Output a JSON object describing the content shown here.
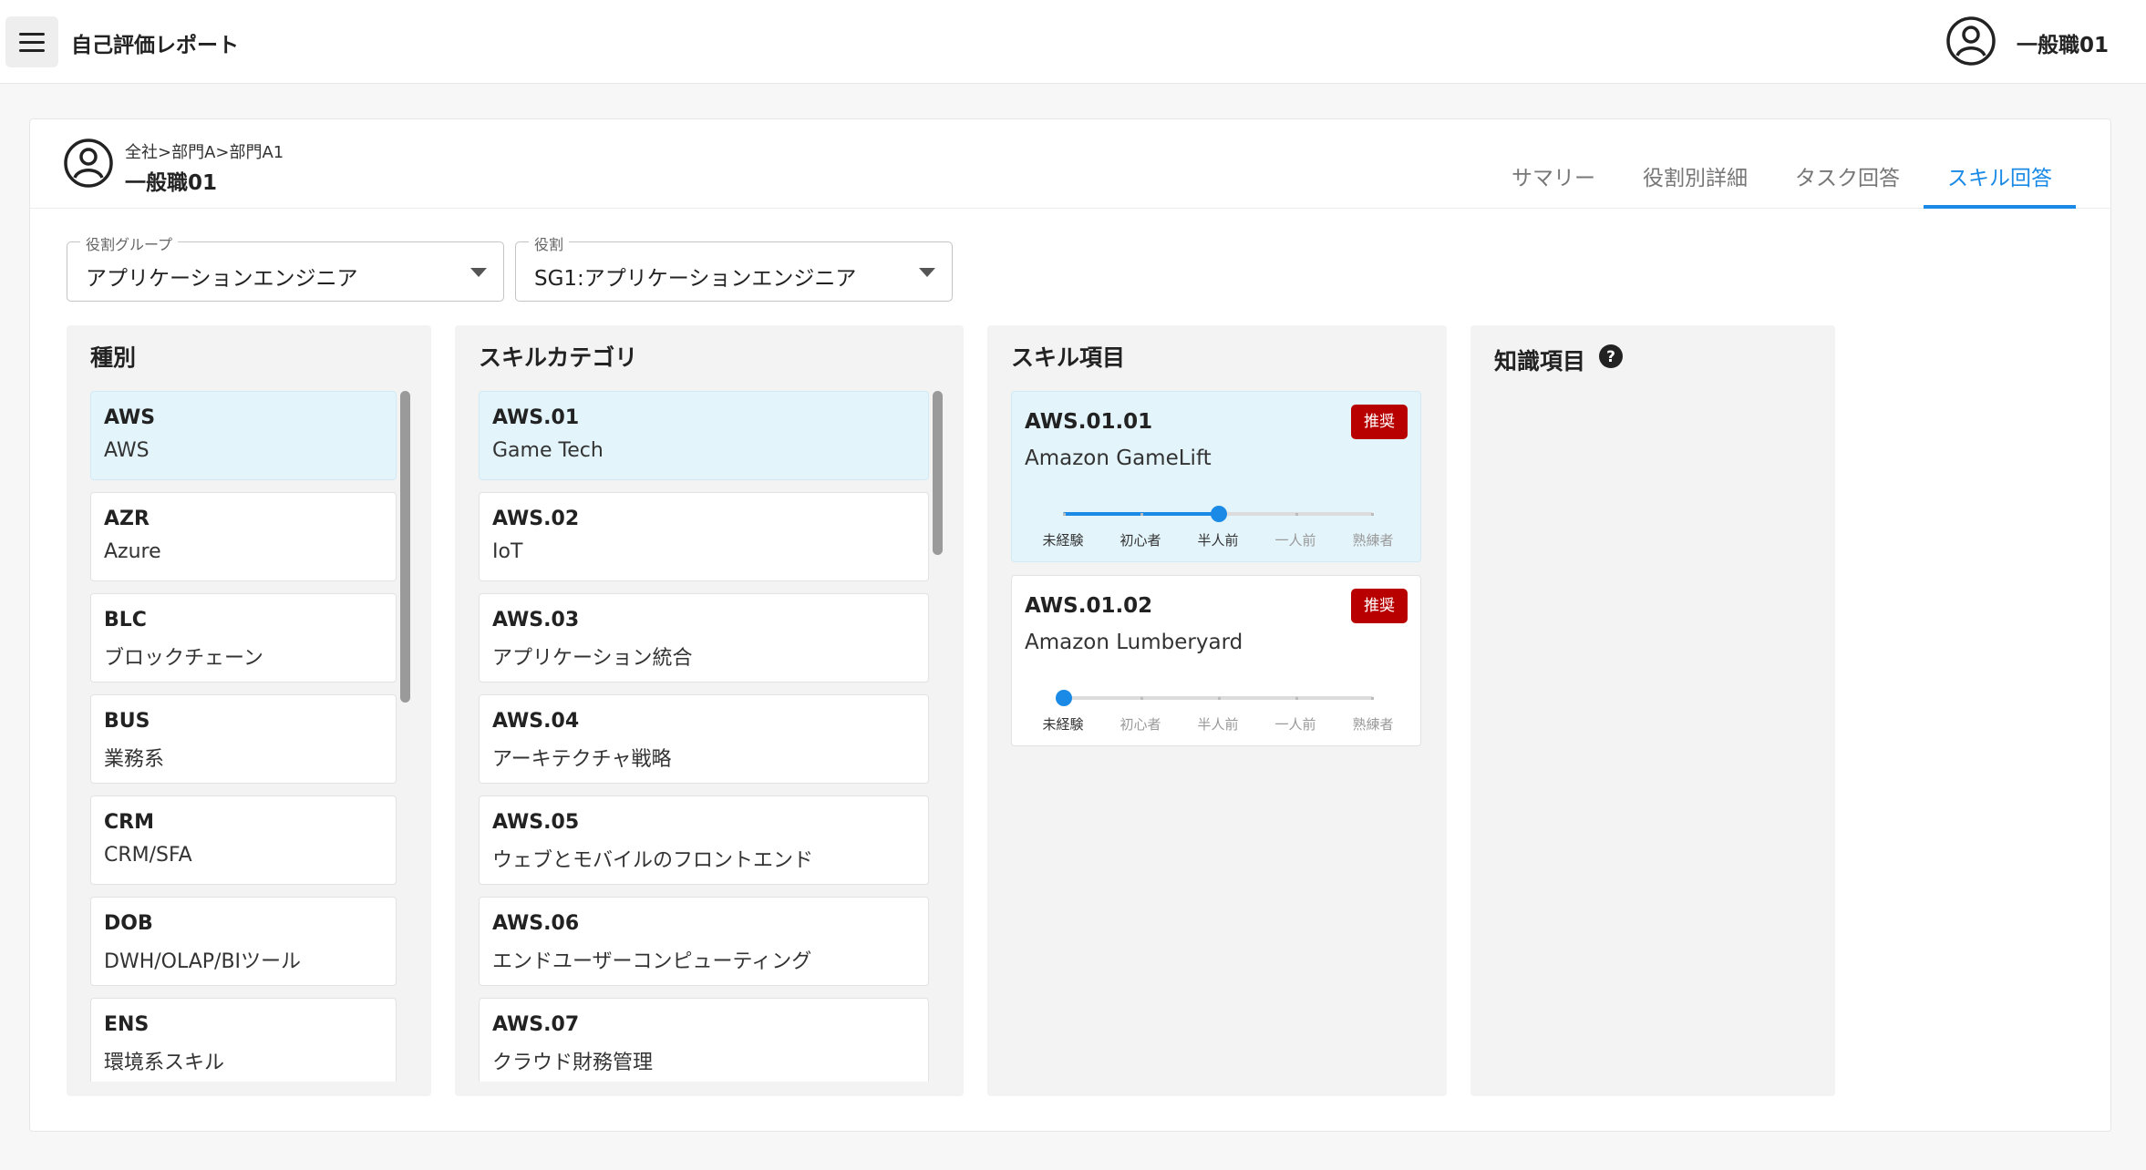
{
  "app": {
    "title": "自己評価レポート"
  },
  "user": {
    "name": "一般職01"
  },
  "employee": {
    "path": "全社>部門A>部門A1",
    "name": "一般職01"
  },
  "tabs": [
    {
      "label": "サマリー",
      "active": false
    },
    {
      "label": "役割別詳細",
      "active": false
    },
    {
      "label": "タスク回答",
      "active": false
    },
    {
      "label": "スキル回答",
      "active": true
    }
  ],
  "filters": {
    "role_group": {
      "label": "役割グループ",
      "value": "アプリケーションエンジニア"
    },
    "role": {
      "label": "役割",
      "value": "SG1:アプリケーションエンジニア"
    }
  },
  "types": {
    "title": "種別",
    "items": [
      {
        "code": "AWS",
        "name": "AWS"
      },
      {
        "code": "AZR",
        "name": "Azure"
      },
      {
        "code": "BLC",
        "name": "ブロックチェーン"
      },
      {
        "code": "BUS",
        "name": "業務系"
      },
      {
        "code": "CRM",
        "name": "CRM/SFA"
      },
      {
        "code": "DOB",
        "name": "DWH/OLAP/BIツール"
      },
      {
        "code": "ENS",
        "name": "環境系スキル"
      }
    ]
  },
  "categories": {
    "title": "スキルカテゴリ",
    "items": [
      {
        "code": "AWS.01",
        "name": "Game Tech"
      },
      {
        "code": "AWS.02",
        "name": "IoT"
      },
      {
        "code": "AWS.03",
        "name": "アプリケーション統合"
      },
      {
        "code": "AWS.04",
        "name": "アーキテクチャ戦略"
      },
      {
        "code": "AWS.05",
        "name": "ウェブとモバイルのフロントエンド"
      },
      {
        "code": "AWS.06",
        "name": "エンドユーザーコンピューティング"
      },
      {
        "code": "AWS.07",
        "name": "クラウド財務管理"
      }
    ]
  },
  "skills": {
    "title": "スキル項目",
    "levels": [
      "未経験",
      "初心者",
      "半人前",
      "一人前",
      "熟練者"
    ],
    "items": [
      {
        "code": "AWS.01.01",
        "name": "Amazon GameLift",
        "badge": "推奨",
        "level_index": 2
      },
      {
        "code": "AWS.01.02",
        "name": "Amazon Lumberyard",
        "badge": "推奨",
        "level_index": 0
      }
    ]
  },
  "knowledge": {
    "title": "知識項目"
  },
  "colors": {
    "accent": "#1a8ae6",
    "badge": "#b80000",
    "selected_bg": "#e3f4fb"
  }
}
